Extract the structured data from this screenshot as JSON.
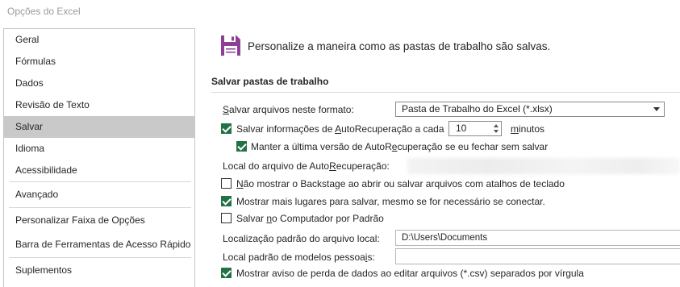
{
  "window": {
    "title": "Opções do Excel"
  },
  "sidebar": {
    "items": [
      {
        "label": "Geral",
        "selected": false
      },
      {
        "label": "Fórmulas",
        "selected": false
      },
      {
        "label": "Dados",
        "selected": false
      },
      {
        "label": "Revisão de Texto",
        "selected": false
      },
      {
        "label": "Salvar",
        "selected": true
      },
      {
        "label": "Idioma",
        "selected": false
      },
      {
        "label": "Acessibilidade",
        "selected": false
      },
      {
        "label": "Avançado",
        "selected": false
      },
      {
        "label": "Personalizar Faixa de Opções",
        "selected": false
      },
      {
        "label": "Barra de Ferramentas de Acesso Rápido",
        "selected": false
      },
      {
        "label": "Suplementos",
        "selected": false
      }
    ]
  },
  "main": {
    "header": "Personalize a maneira como as pastas de trabalho são salvas.",
    "section_title": "Salvar pastas de trabalho",
    "save_format": {
      "label_u": "S",
      "label_rest": "alvar arquivos neste formato:",
      "value": "Pasta de Trabalho do Excel (*.xlsx)"
    },
    "autorecover": {
      "checked": true,
      "label_pre": "Salvar informações de ",
      "label_u": "A",
      "label_post": "utoRecuperação a cada",
      "value": "10",
      "unit_u": "m",
      "unit_rest": "inutos"
    },
    "keep_last": {
      "checked": true,
      "label_pre": "Manter a última versão de AutoR",
      "label_u": "e",
      "label_post": "cuperação se eu fechar sem salvar"
    },
    "autorecover_location": {
      "label_pre": "Local do arquivo de Auto",
      "label_u": "R",
      "label_post": "ecuperação:"
    },
    "no_backstage": {
      "checked": false,
      "label_u": "N",
      "label_rest": "ão mostrar o Backstage ao abrir ou salvar arquivos com atalhos de teclado"
    },
    "more_places": {
      "checked": true,
      "label": "Mostrar mais lugares para salvar, mesmo se for necessário se conectar."
    },
    "save_to_computer": {
      "checked": false,
      "label_pre": "Salvar ",
      "label_u": "n",
      "label_post": "o Computador por Padrão"
    },
    "default_location": {
      "label": "Localização padrão do arquivo local:",
      "value": "D:\\Users\\Documents"
    },
    "templates_location": {
      "label_pre": "Local padrão de modelos pessoa",
      "label_u": "i",
      "label_post": "s:",
      "value": ""
    },
    "csv_warning": {
      "checked": true,
      "label": "Mostrar aviso de perda de dados ao editar arquivos (*.csv) separados por vírgula"
    }
  },
  "colors": {
    "accent": "#217346",
    "selected_nav": "#c9c9c9",
    "save_icon": "#8e3e96"
  }
}
